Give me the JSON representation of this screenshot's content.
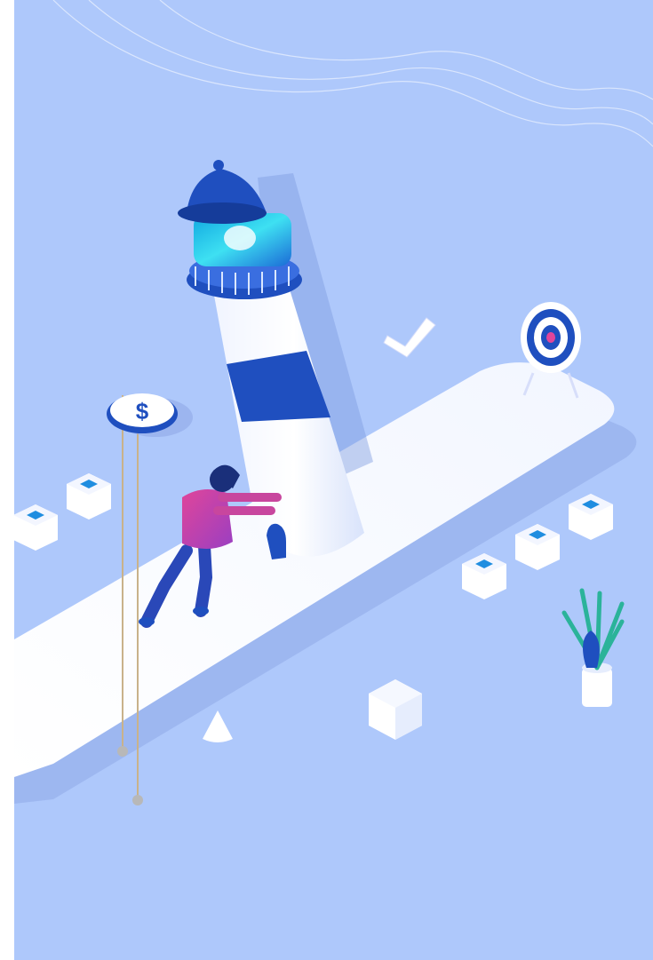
{
  "illustration": {
    "subject": "",
    "colors": {
      "background": "#aec8fb",
      "primary_blue": "#1f4fbf",
      "cyan_light": "#3ee0f2",
      "white": "#ffffff",
      "accent_pink": "#e0459a",
      "accent_purple": "#9a3fc2",
      "plant_green": "#2bb39a",
      "stem_line": "#c9b28a"
    },
    "icons": [
      "lighthouse-icon",
      "person-pushing-icon",
      "dollar-coin-icon",
      "target-icon",
      "checkmark-icon",
      "plant-icon",
      "cube-icon",
      "cone-icon"
    ],
    "coin_symbol": "$"
  }
}
